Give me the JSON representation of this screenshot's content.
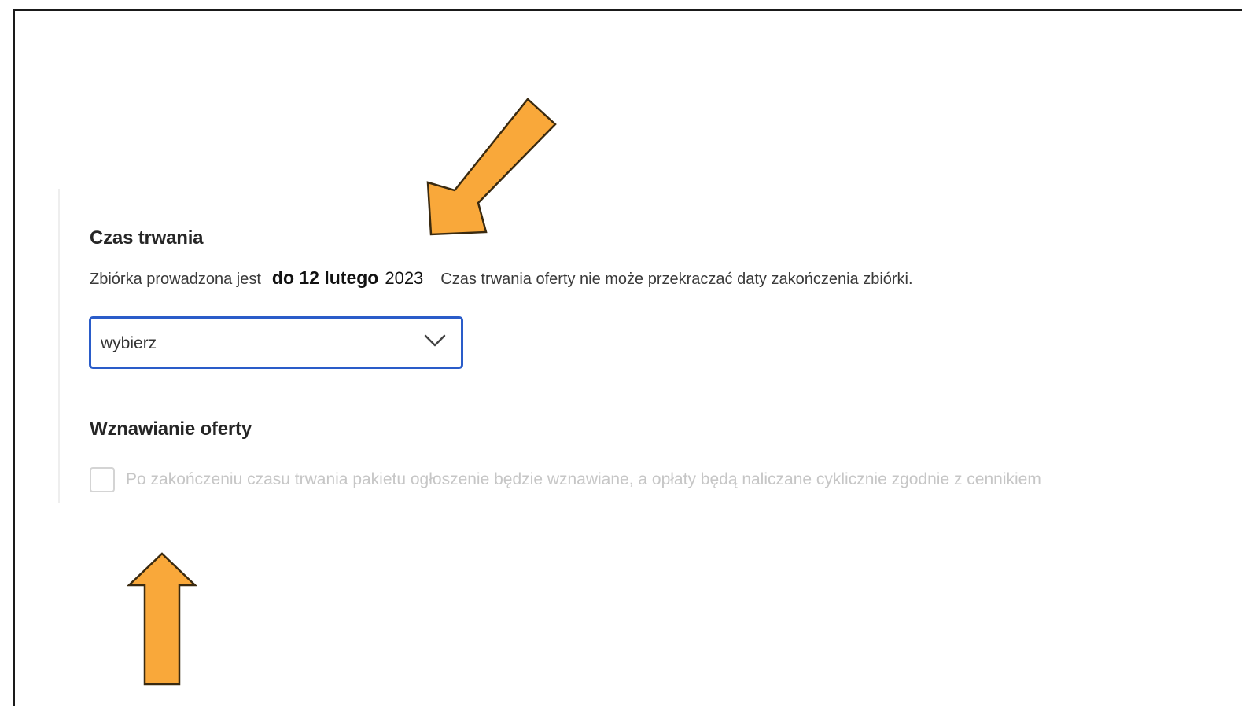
{
  "duration": {
    "heading": "Czas trwania",
    "description_prefix": "Zbiórka prowadzona jest",
    "description_date": "do 12 lutego",
    "description_year": "2023",
    "description_suffix": "Czas trwania oferty nie może przekraczać daty zakończenia zbiórki.",
    "select_value": "wybierz"
  },
  "renewal": {
    "heading": "Wznawianie oferty",
    "checkbox_label": "Po zakończeniu czasu trwania pakietu ogłoszenie będzie wznawiane, a opłaty będą naliczane cyklicznie zgodnie z cennikiem",
    "checked": false
  },
  "icons": {
    "select_chevron": "chevron-down-icon",
    "annotation_arrow_1": "arrow-down-left-icon",
    "annotation_arrow_2": "arrow-up-icon"
  },
  "colors": {
    "select_border": "#2a5cc9",
    "arrow_fill": "#f9a83a",
    "arrow_outline": "#3a2a10",
    "disabled_text": "#c6c6c6"
  }
}
